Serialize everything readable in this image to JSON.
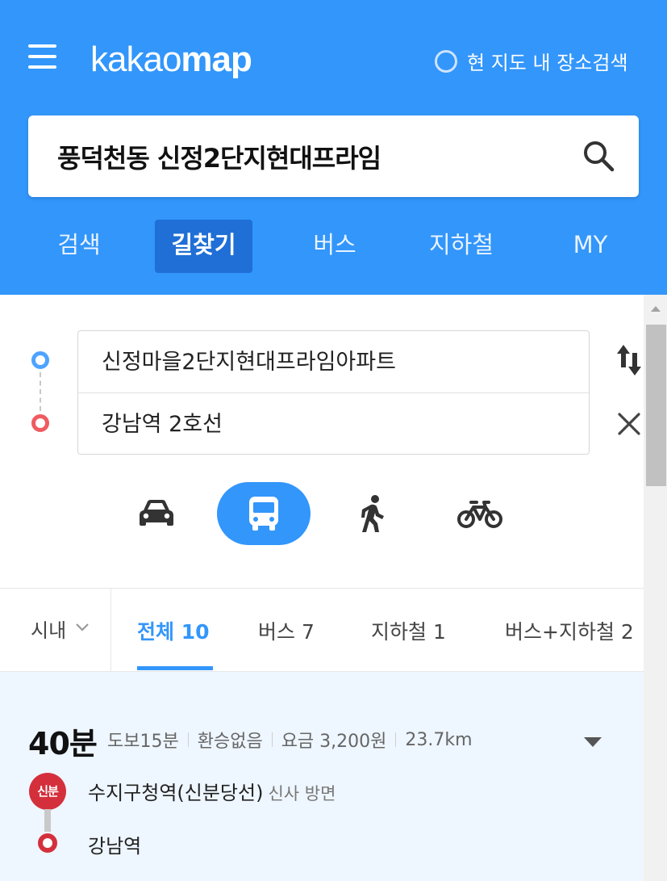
{
  "app": {
    "logo_part1": "kakao",
    "logo_part2": "map",
    "map_search_label": "현 지도 내 장소검색",
    "accent_color": "#3296fb"
  },
  "search": {
    "query": "풍덕천동 신정2단지현대프라임"
  },
  "nav_tabs": [
    {
      "label": "검색",
      "active": false
    },
    {
      "label": "길찾기",
      "active": true
    },
    {
      "label": "버스",
      "active": false
    },
    {
      "label": "지하철",
      "active": false
    },
    {
      "label": "MY",
      "active": false
    }
  ],
  "route": {
    "origin": "신정마을2단지현대프라임아파트",
    "destination": "강남역 2호선",
    "modes": [
      {
        "icon": "car-icon",
        "active": false
      },
      {
        "icon": "bus-icon",
        "active": true
      },
      {
        "icon": "walk-icon",
        "active": false
      },
      {
        "icon": "bicycle-icon",
        "active": false
      }
    ]
  },
  "filter": {
    "region": "시내",
    "tabs": [
      {
        "label": "전체 10",
        "active": true
      },
      {
        "label": "버스 7",
        "active": false
      },
      {
        "label": "지하철 1",
        "active": false
      },
      {
        "label": "버스+지하철 2",
        "active": false
      }
    ]
  },
  "result": {
    "time": "40분",
    "walk": "도보15분",
    "transfer": "환승없음",
    "fare": "요금 3,200원",
    "distance": "23.7km",
    "line_badge": "신분",
    "line_color": "#d4303c",
    "start_station": "수지구청역(신분당선)",
    "direction": "신사 방면",
    "end_station": "강남역"
  }
}
